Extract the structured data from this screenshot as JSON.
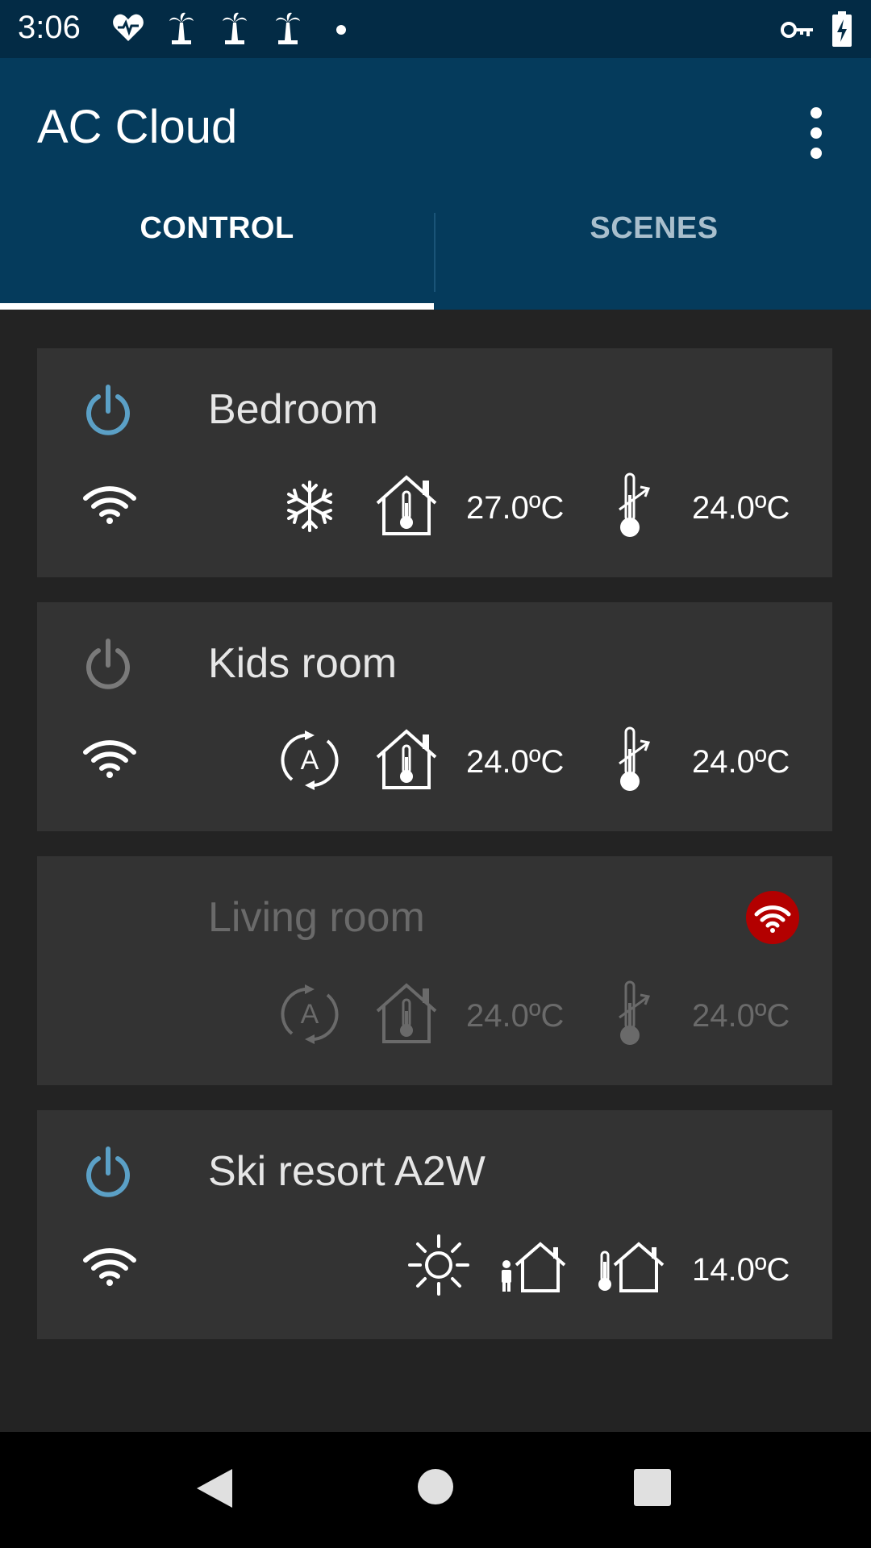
{
  "status_bar": {
    "time": "3:06",
    "icons": [
      "heart-pulse-icon",
      "palm-tree-icon",
      "palm-tree-icon",
      "palm-tree-icon",
      "dot-icon",
      "vpn-key-icon",
      "battery-charging-icon"
    ]
  },
  "app_bar": {
    "title": "AC Cloud",
    "tabs": [
      {
        "label": "CONTROL",
        "selected": true
      },
      {
        "label": "SCENES",
        "selected": false
      }
    ]
  },
  "colors": {
    "status_bar": "#032b45",
    "app_bar": "#053b5c",
    "card": "#333333",
    "power_on": "#5ba0c6",
    "power_off": "#7a7a7a",
    "offline_badge": "#b30000"
  },
  "devices": [
    {
      "name": "Bedroom",
      "power": "on",
      "connection": "wifi",
      "mode_icon": "snowflake-icon",
      "indoor_temp": "27.0ºC",
      "set_temp": "24.0ºC"
    },
    {
      "name": "Kids room",
      "power": "off",
      "connection": "wifi",
      "mode_icon": "auto-mode-icon",
      "indoor_temp": "24.0ºC",
      "set_temp": "24.0ºC"
    },
    {
      "name": "Living room",
      "power": "unavailable",
      "connection": "offline",
      "mode_icon": "auto-mode-icon",
      "indoor_temp": "24.0ºC",
      "set_temp": "24.0ºC"
    },
    {
      "name": "Ski resort A2W",
      "power": "on",
      "connection": "wifi",
      "mode_icon": "sun-icon",
      "extra_icons": [
        "person-home-icon",
        "thermometer-home-icon"
      ],
      "set_temp": "14.0ºC"
    }
  ],
  "nav_bar": {
    "buttons": [
      "back-icon",
      "home-icon",
      "recents-icon"
    ]
  }
}
